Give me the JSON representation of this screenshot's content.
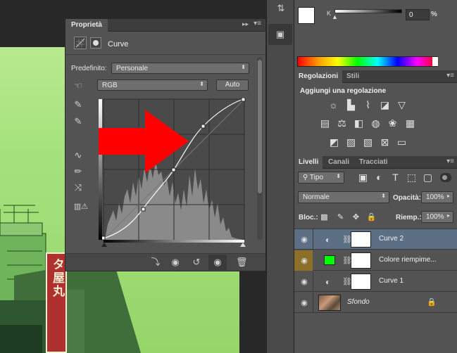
{
  "properties": {
    "tab_label": "Proprietà",
    "panel_name": "Curve",
    "preset_label": "Predefinito:",
    "preset_value": "Personale",
    "channel_value": "RGB",
    "auto_label": "Auto"
  },
  "color_panel": {
    "k_label": "K",
    "k_value": "0",
    "k_unit": "%"
  },
  "adjustments": {
    "tabs": [
      "Regolazioni",
      "Stili"
    ],
    "heading": "Aggiungi una regolazione"
  },
  "layers_panel": {
    "tabs": [
      "Livelli",
      "Canali",
      "Tracciati"
    ],
    "filter_label": "Tipo",
    "blend_mode": "Normale",
    "opacity_label": "Opacità:",
    "opacity_value": "100%",
    "lock_label": "Bloc.:",
    "fill_label": "Riemp.:",
    "fill_value": "100%",
    "layers": [
      {
        "name": "Curve 2",
        "selected": true
      },
      {
        "name": "Colore riempime...",
        "selected": false
      },
      {
        "name": "Curve 1",
        "selected": false
      },
      {
        "name": "Sfondo",
        "selected": false
      }
    ]
  },
  "photo_sign": {
    "text": "タ屋丸"
  },
  "colors": {
    "panel_bg": "#535353",
    "selected_layer": "#5d6f85",
    "fill_swatch": "#00ff00",
    "arrow": "#ff0000",
    "eye_highlight": "#8c6f28"
  }
}
